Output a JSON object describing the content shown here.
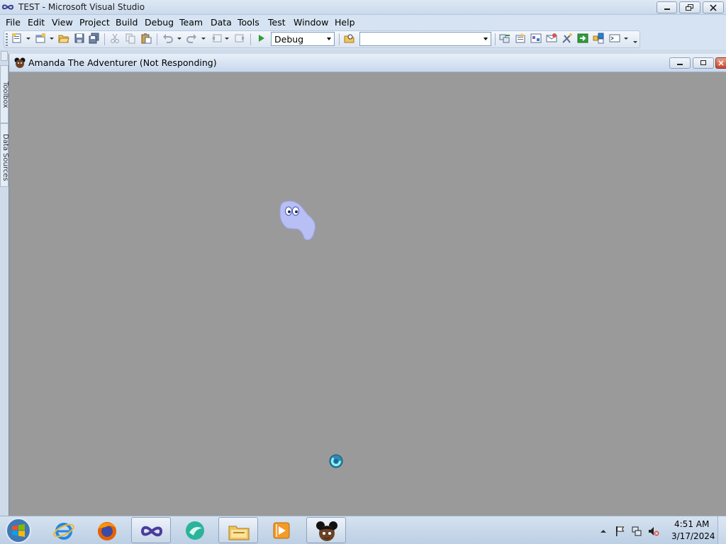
{
  "vs_window": {
    "title": "TEST - Microsoft Visual Studio",
    "menu": [
      "File",
      "Edit",
      "View",
      "Project",
      "Build",
      "Debug",
      "Team",
      "Data",
      "Tools",
      "Test",
      "Window",
      "Help"
    ],
    "toolbar": {
      "configuration": "Debug",
      "platform_value": "",
      "icons": [
        "new-project-icon",
        "add-item-icon",
        "open-file-icon",
        "save-icon",
        "save-all-icon",
        "cut-icon",
        "copy-icon",
        "paste-icon",
        "undo-icon",
        "redo-icon",
        "navigate-backward-icon",
        "navigate-forward-icon",
        "start-debugging-icon",
        "find-in-files-icon",
        "solution-explorer-icon",
        "properties-icon",
        "object-browser-icon",
        "team-explorer-icon",
        "toolbox-icon",
        "start-page-icon",
        "extension-manager-icon",
        "command-window-icon"
      ]
    }
  },
  "dock": {
    "tabs": [
      "Toolbox",
      "Data Sources"
    ]
  },
  "game_window": {
    "title": "Amanda The Adventurer (Not Responding)",
    "canvas_color": "#9a9a9a"
  },
  "taskbar": {
    "apps": [
      "internet-explorer-icon",
      "firefox-icon",
      "visual-studio-icon",
      "media-app-icon",
      "file-explorer-icon",
      "media-player-icon",
      "amanda-game-icon"
    ],
    "active_app": "amanda-game-icon",
    "clock": {
      "time": "4:51 AM",
      "date": "3/17/2024"
    }
  },
  "colors": {
    "vs_chrome": "#d6e3f2",
    "taskbar": "#c7d7ea",
    "ghost": "#b7bff5",
    "close_button": "#d9534f"
  }
}
